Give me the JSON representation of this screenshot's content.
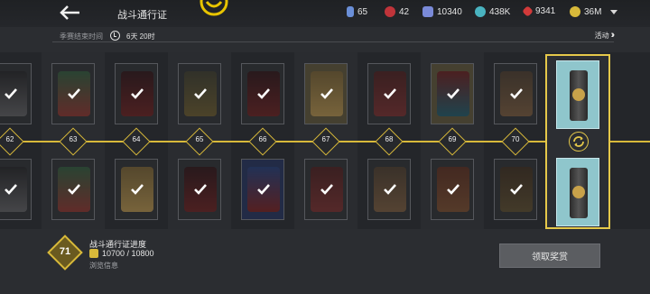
{
  "header": {
    "title": "战斗通行证",
    "currencies": [
      {
        "icon": "credit-icon",
        "value": "65",
        "color": "#6a8fd8"
      },
      {
        "icon": "red-token-icon",
        "value": "42",
        "color": "#c0343a"
      },
      {
        "icon": "ticket-icon",
        "value": "10340",
        "color": "#7a8ad8"
      },
      {
        "icon": "teal-coin-icon",
        "value": "438K",
        "color": "#49b3c0"
      },
      {
        "icon": "red-gem-icon",
        "value": "9341",
        "color": "#d23a3a"
      },
      {
        "icon": "gold-coin-icon",
        "value": "36M",
        "color": "#d8b93a"
      }
    ]
  },
  "season": {
    "label": "季赛结束时间",
    "time": "6天 20时",
    "activity": "活动"
  },
  "track": {
    "levels": [
      "62",
      "63",
      "64",
      "65",
      "66",
      "67",
      "68",
      "69",
      "70"
    ],
    "accent": "#d8b93a"
  },
  "progress": {
    "level": "71",
    "title": "战斗通行证进度",
    "value": "10700 / 10800",
    "browse": "浏览信息"
  },
  "claim_label": "领取奖赏"
}
